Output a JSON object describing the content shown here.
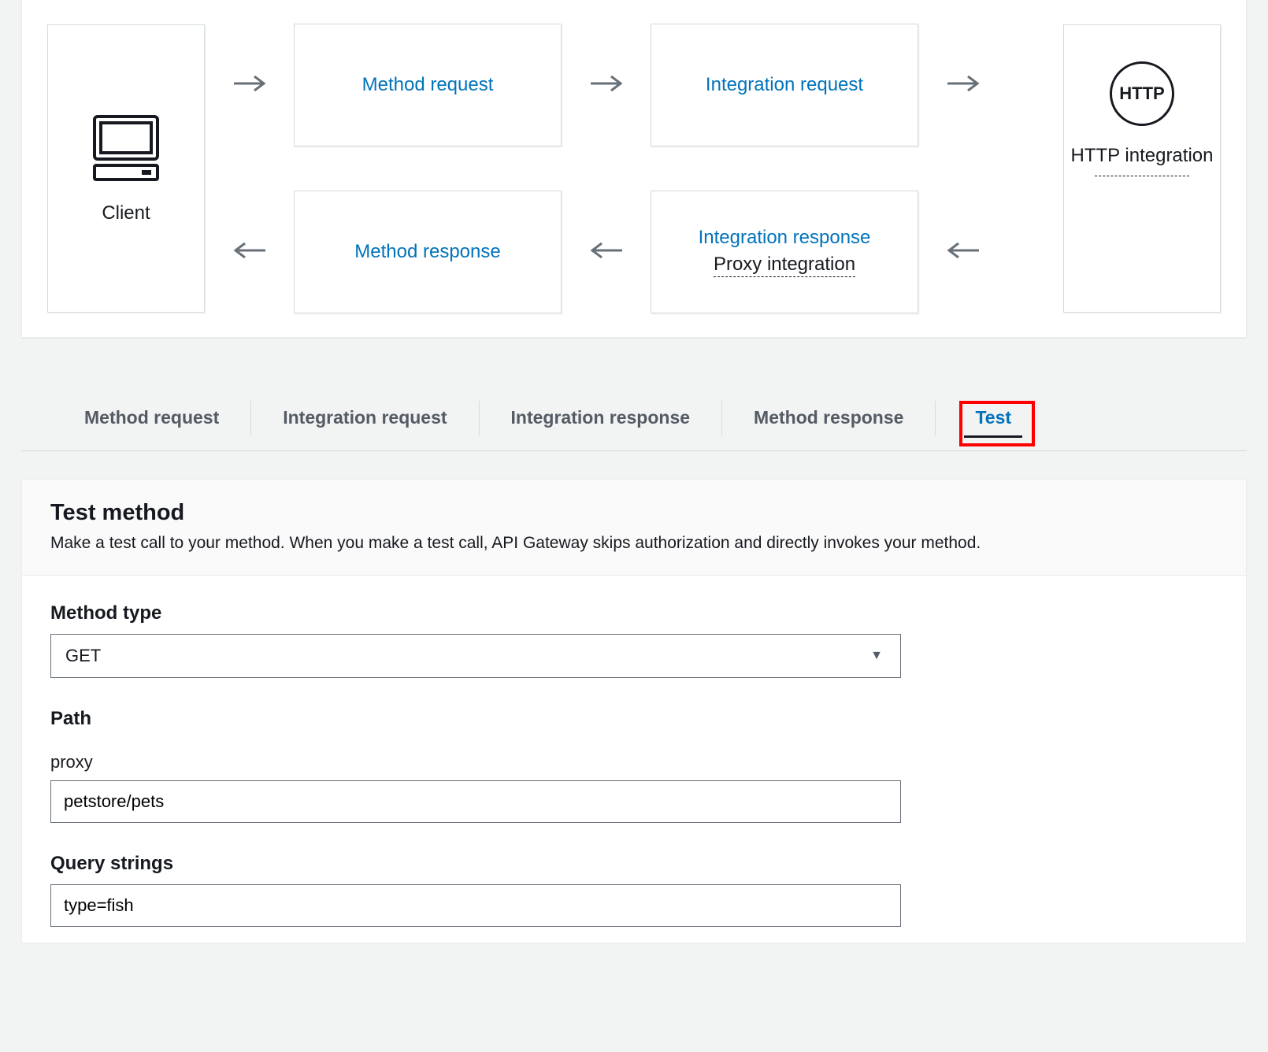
{
  "diagram": {
    "client_label": "Client",
    "method_request": "Method request",
    "integration_request": "Integration request",
    "method_response": "Method response",
    "integration_response": "Integration response",
    "proxy_integration": "Proxy integration",
    "http_badge": "HTTP",
    "endpoint_label": "HTTP integration"
  },
  "tabs": {
    "items": [
      "Method request",
      "Integration request",
      "Integration response",
      "Method response"
    ],
    "active": "Test"
  },
  "test_method": {
    "title": "Test method",
    "description": "Make a test call to your method. When you make a test call, API Gateway skips authorization and directly invokes your method.",
    "method_type_label": "Method type",
    "method_type_value": "GET",
    "path_label": "Path",
    "proxy_label": "proxy",
    "proxy_value": "petstore/pets",
    "query_strings_label": "Query strings",
    "query_strings_value": "type=fish"
  }
}
